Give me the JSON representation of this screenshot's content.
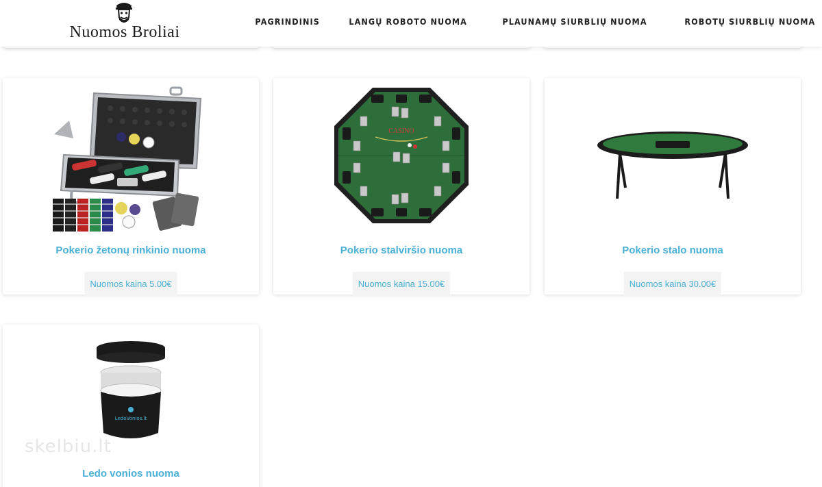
{
  "header": {
    "logo_text": "Nuomos Broliai",
    "nav": [
      "PAGRINDINIS",
      "LANGŲ ROBOTO NUOMA",
      "PLAUNAMŲ SIURBLIŲ NUOMA",
      "ROBOTŲ SIURBLIŲ NUOMA"
    ]
  },
  "products": [
    {
      "title": "Pokerio žetonų rinkinio nuoma",
      "price": "Nuomos kaina 5.00€"
    },
    {
      "title": "Pokerio stalviršio nuoma",
      "price": "Nuomos kaina 15.00€"
    },
    {
      "title": "Pokerio stalo nuoma",
      "price": "Nuomos kaina 30.00€"
    },
    {
      "title": "Ledo vonios nuoma"
    }
  ],
  "product_images": {
    "tub_brand": "LedoVonios.lt",
    "table_top_text": "CASINO"
  },
  "watermark": "skelbiu.lt",
  "colors": {
    "accent": "#4ab0d6",
    "price_bg": "#f3f3f3",
    "felt_green": "#2e6e3a"
  }
}
